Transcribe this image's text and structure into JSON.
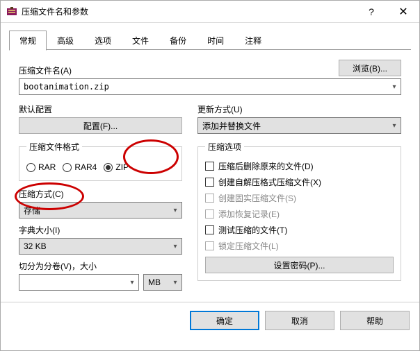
{
  "titlebar": {
    "title": "压缩文件名和参数"
  },
  "tabs": {
    "items": [
      "常规",
      "高级",
      "选项",
      "文件",
      "备份",
      "时间",
      "注释"
    ],
    "active": 0
  },
  "filename": {
    "label": "压缩文件名(A)",
    "value": "bootanimation.zip",
    "browse": "浏览(B)..."
  },
  "default_profile": {
    "label": "默认配置",
    "button": "配置(F)..."
  },
  "update_mode": {
    "label": "更新方式(U)",
    "value": "添加并替换文件"
  },
  "format": {
    "label": "压缩文件格式",
    "options": [
      "RAR",
      "RAR4",
      "ZIP"
    ],
    "selected": "ZIP"
  },
  "method": {
    "label": "压缩方式(C)",
    "value": "存储"
  },
  "dict": {
    "label": "字典大小(I)",
    "value": "32 KB"
  },
  "split": {
    "label": "切分为分卷(V)，大小",
    "value": "",
    "unit": "MB"
  },
  "options": {
    "label": "压缩选项",
    "items": [
      {
        "label": "压缩后删除原来的文件(D)",
        "checked": false,
        "disabled": false
      },
      {
        "label": "创建自解压格式压缩文件(X)",
        "checked": false,
        "disabled": false
      },
      {
        "label": "创建固实压缩文件(S)",
        "checked": false,
        "disabled": true
      },
      {
        "label": "添加恢复记录(E)",
        "checked": false,
        "disabled": true
      },
      {
        "label": "测试压缩的文件(T)",
        "checked": false,
        "disabled": false
      },
      {
        "label": "锁定压缩文件(L)",
        "checked": false,
        "disabled": true
      }
    ],
    "password_button": "设置密码(P)..."
  },
  "footer": {
    "ok": "确定",
    "cancel": "取消",
    "help": "帮助"
  }
}
